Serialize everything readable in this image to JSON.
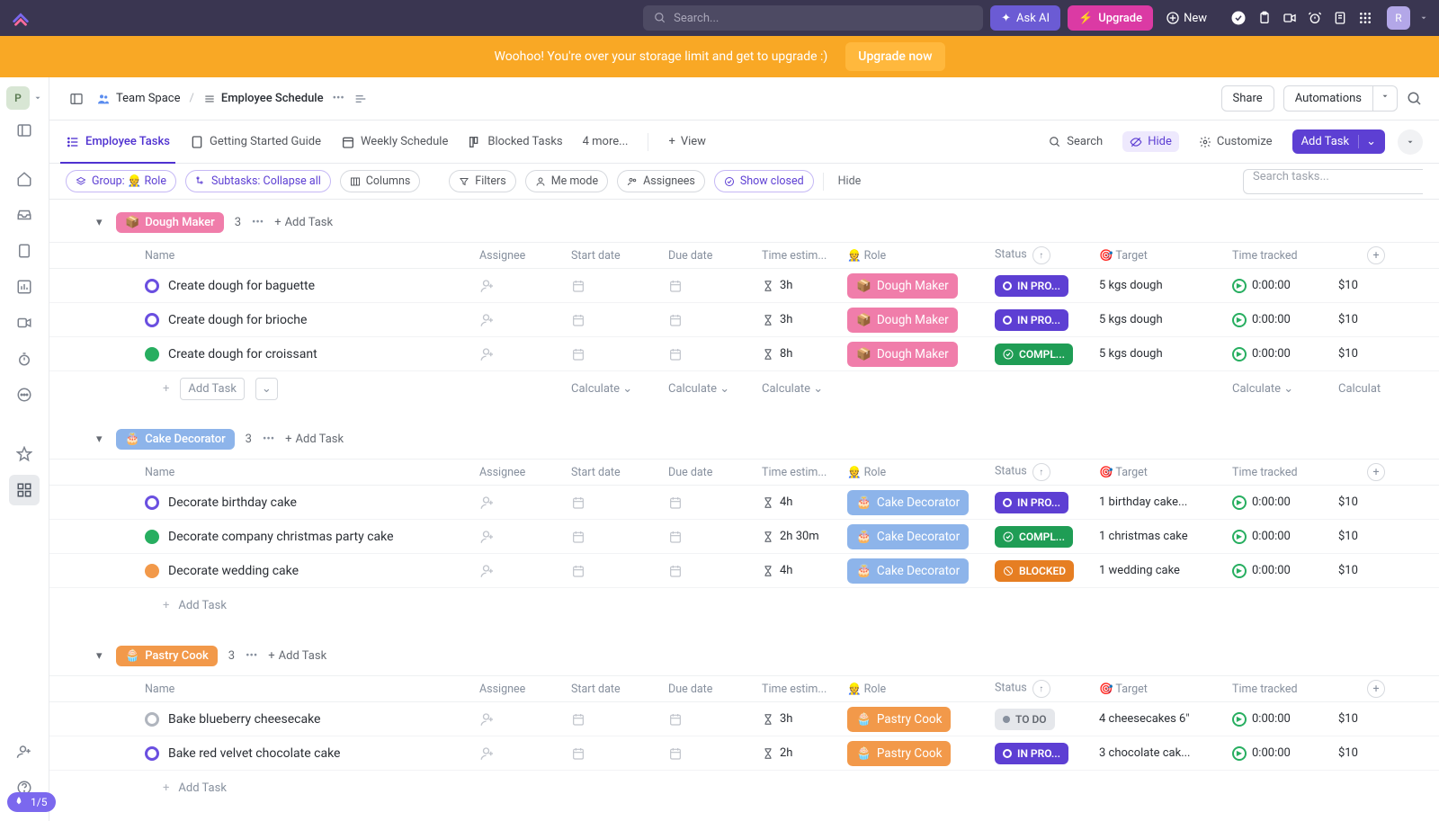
{
  "topbar": {
    "search_placeholder": "Search...",
    "ask_ai": "Ask AI",
    "upgrade": "Upgrade",
    "new": "New",
    "avatar_initial": "R"
  },
  "banner": {
    "text": "Woohoo! You're over your storage limit and get to upgrade :)",
    "button": "Upgrade now"
  },
  "workspace_initial": "P",
  "journey_progress": "1/5",
  "breadcrumb": {
    "space": "Team Space",
    "list": "Employee Schedule",
    "share": "Share",
    "automations": "Automations"
  },
  "tabs": {
    "employee_tasks": "Employee Tasks",
    "getting_started": "Getting Started Guide",
    "weekly_schedule": "Weekly Schedule",
    "blocked_tasks": "Blocked Tasks",
    "more": "4 more...",
    "view": "View",
    "search": "Search",
    "hide": "Hide",
    "customize": "Customize",
    "add_task": "Add Task"
  },
  "filters": {
    "group": "Group: 👷 Role",
    "subtasks": "Subtasks: Collapse all",
    "columns": "Columns",
    "filters": "Filters",
    "me_mode": "Me mode",
    "assignees": "Assignees",
    "show_closed": "Show closed",
    "hide": "Hide",
    "search_placeholder": "Search tasks..."
  },
  "columns": {
    "name": "Name",
    "assignee": "Assignee",
    "start_date": "Start date",
    "due_date": "Due date",
    "time_estimate": "Time estim...",
    "role": "👷 Role",
    "status": "Status",
    "target": "🎯 Target",
    "time_tracked": "Time tracked"
  },
  "shared": {
    "add_task": "Add Task",
    "calculate": "Calculate"
  },
  "groups": [
    {
      "emoji": "📦",
      "name": "Dough Maker",
      "count": "3",
      "color": "#f07daa",
      "tasks": [
        {
          "dot": "open",
          "name": "Create dough for baguette",
          "time": "3h",
          "role": "Dough Maker",
          "role_emoji": "📦",
          "role_color": "#f07daa",
          "status": "inprog",
          "status_label": "IN PRO...",
          "target": "5 kgs dough",
          "tracked": "0:00:00",
          "cost": "$10"
        },
        {
          "dot": "open",
          "name": "Create dough for brioche",
          "time": "3h",
          "role": "Dough Maker",
          "role_emoji": "📦",
          "role_color": "#f07daa",
          "status": "inprog",
          "status_label": "IN PRO...",
          "target": "5 kgs dough",
          "tracked": "0:00:00",
          "cost": "$10"
        },
        {
          "dot": "done",
          "name": "Create dough for croissant",
          "time": "8h",
          "role": "Dough Maker",
          "role_emoji": "📦",
          "role_color": "#f07daa",
          "status": "complete",
          "status_label": "COMPL...",
          "target": "5 kgs dough",
          "tracked": "0:00:00",
          "cost": "$10"
        }
      ],
      "show_calc": true
    },
    {
      "emoji": "🎂",
      "name": "Cake Decorator",
      "count": "3",
      "color": "#8db4ea",
      "tasks": [
        {
          "dot": "open",
          "name": "Decorate birthday cake",
          "time": "4h",
          "role": "Cake Decorator",
          "role_emoji": "🎂",
          "role_color": "#8db4ea",
          "status": "inprog",
          "status_label": "IN PRO...",
          "target": "1 birthday cake...",
          "tracked": "0:00:00",
          "cost": "$10"
        },
        {
          "dot": "done",
          "name": "Decorate company christmas party cake",
          "time": "2h 30m",
          "role": "Cake Decorator",
          "role_emoji": "🎂",
          "role_color": "#8db4ea",
          "status": "complete",
          "status_label": "COMPL...",
          "target": "1 christmas cake",
          "tracked": "0:00:00",
          "cost": "$10"
        },
        {
          "dot": "blocked",
          "name": "Decorate wedding cake",
          "time": "4h",
          "role": "Cake Decorator",
          "role_emoji": "🎂",
          "role_color": "#8db4ea",
          "status": "blocked",
          "status_label": "BLOCKED",
          "target": "1 wedding cake",
          "tracked": "0:00:00",
          "cost": "$10"
        }
      ],
      "show_calc": false
    },
    {
      "emoji": "🧁",
      "name": "Pastry Cook",
      "count": "3",
      "color": "#f2994a",
      "tasks": [
        {
          "dot": "todo",
          "name": "Bake blueberry cheesecake",
          "time": "3h",
          "role": "Pastry Cook",
          "role_emoji": "🧁",
          "role_color": "#f2994a",
          "status": "todo",
          "status_label": "TO DO",
          "target": "4 cheesecakes 6\"",
          "tracked": "0:00:00",
          "cost": "$10"
        },
        {
          "dot": "open",
          "name": "Bake red velvet chocolate cake",
          "time": "2h",
          "role": "Pastry Cook",
          "role_emoji": "🧁",
          "role_color": "#f2994a",
          "status": "inprog",
          "status_label": "IN PRO...",
          "target": "3 chocolate cak...",
          "tracked": "0:00:00",
          "cost": "$10"
        }
      ],
      "show_calc": false
    }
  ]
}
